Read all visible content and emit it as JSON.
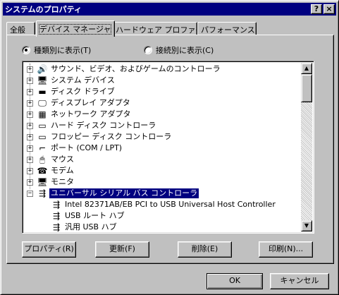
{
  "window": {
    "title": "システムのプロパティ",
    "help_label": "?",
    "close_label": "×"
  },
  "tabs": [
    {
      "label": "全般"
    },
    {
      "label": "デバイス マネージャ",
      "active": true
    },
    {
      "label": "ハードウェア プロファイル"
    },
    {
      "label": "パフォーマンス"
    }
  ],
  "view": {
    "by_type_label": "種類別に表示(T)",
    "by_connection_label": "接続別に表示(C)",
    "selected": "by_type"
  },
  "tree": {
    "items": [
      {
        "label": "サウンド、ビデオ、およびゲームのコントローラ",
        "expander": "+",
        "icon": "speaker-icon",
        "glyph": "🔊"
      },
      {
        "label": "システム デバイス",
        "expander": "+",
        "icon": "computer-icon",
        "glyph": "🖥"
      },
      {
        "label": "ディスク ドライブ",
        "expander": "+",
        "icon": "disk-drive-icon",
        "glyph": "▬"
      },
      {
        "label": "ディスプレイ アダプタ",
        "expander": "+",
        "icon": "display-adapter-icon",
        "glyph": "🖵"
      },
      {
        "label": "ネットワーク アダプタ",
        "expander": "+",
        "icon": "network-card-icon",
        "glyph": "▦"
      },
      {
        "label": "ハード ディスク コントローラ",
        "expander": "+",
        "icon": "hdd-controller-icon",
        "glyph": "▭"
      },
      {
        "label": "フロッピー ディスク コントローラ",
        "expander": "+",
        "icon": "floppy-controller-icon",
        "glyph": "▭"
      },
      {
        "label": "ポート (COM / LPT)",
        "expander": "+",
        "icon": "port-icon",
        "glyph": "⌐"
      },
      {
        "label": "マウス",
        "expander": "+",
        "icon": "mouse-icon",
        "glyph": "🖱"
      },
      {
        "label": "モデム",
        "expander": "+",
        "icon": "modem-icon",
        "glyph": "☎"
      },
      {
        "label": "モニタ",
        "expander": "+",
        "icon": "monitor-icon",
        "glyph": "🖥"
      },
      {
        "label": "ユニバーサル シリアル バス コントローラ",
        "expander": "−",
        "icon": "usb-icon",
        "glyph": "⇶",
        "selected": true
      }
    ],
    "children": [
      {
        "label": "Intel 82371AB/EB PCI to USB Universal Host Controller",
        "icon": "usb-icon",
        "glyph": "⇶"
      },
      {
        "label": "USB ルート ハブ",
        "icon": "usb-icon",
        "glyph": "⇶"
      },
      {
        "label": "汎用 USB ハブ",
        "icon": "usb-icon",
        "glyph": "⇶"
      }
    ]
  },
  "buttons": {
    "properties": "プロパティ(R)",
    "refresh": "更新(F)",
    "remove": "削除(E)",
    "print": "印刷(N)...",
    "ok": "OK",
    "cancel": "キャンセル"
  },
  "colors": {
    "titlebar": "#000080",
    "face": "#c0c0c0",
    "selection": "#000080"
  }
}
